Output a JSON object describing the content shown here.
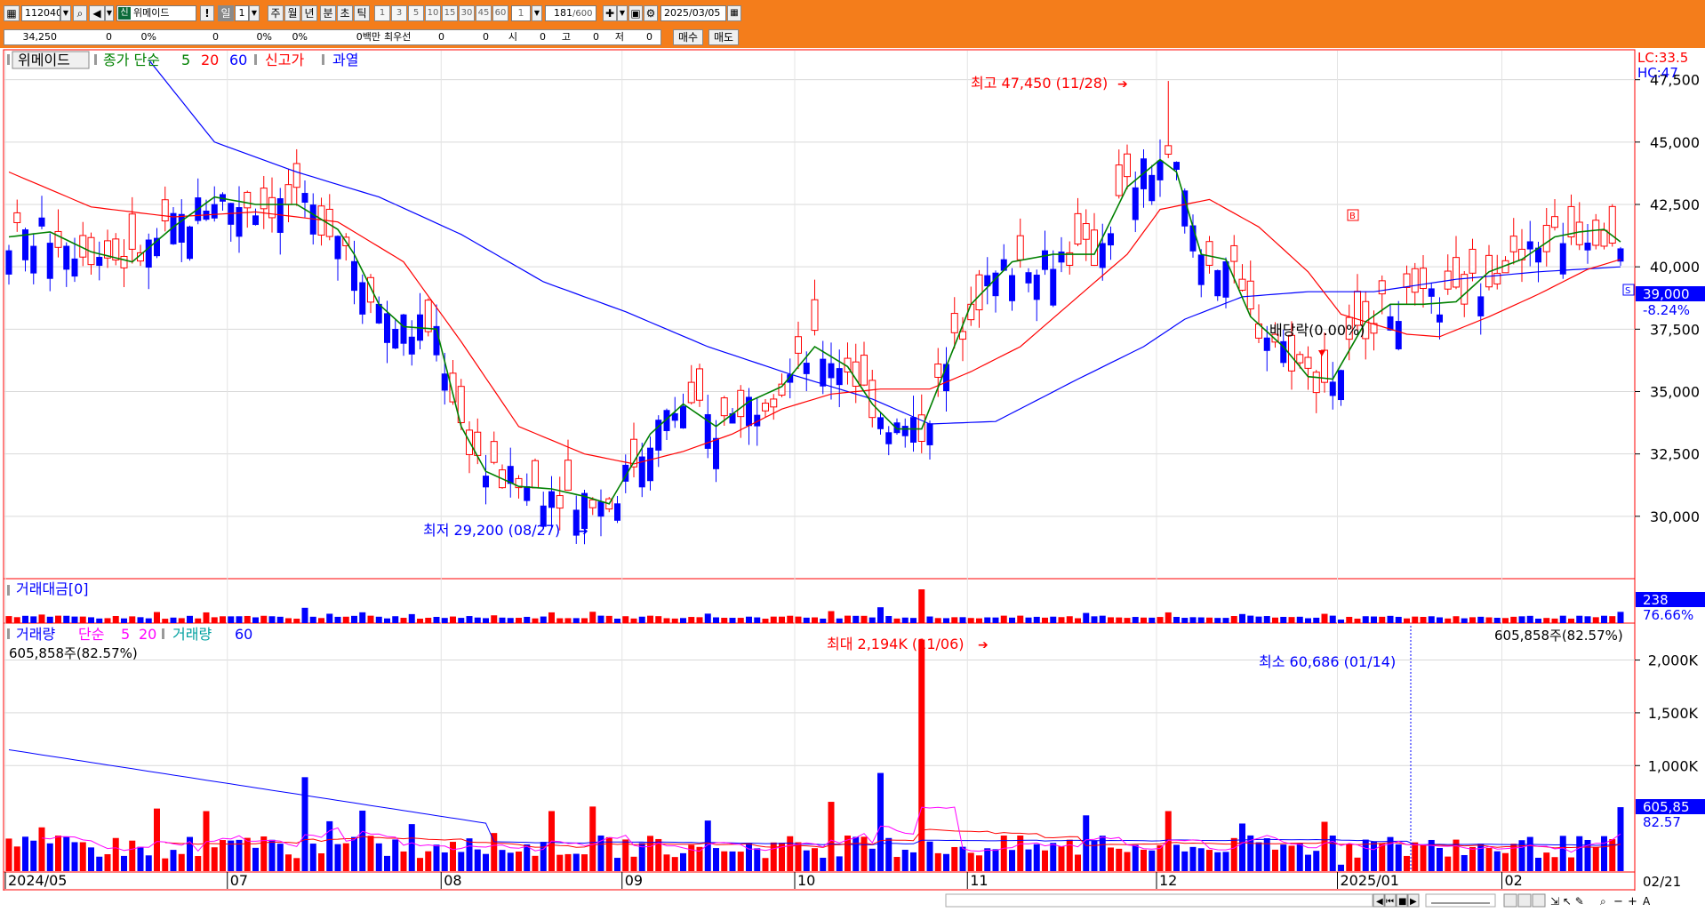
{
  "toolbar": {
    "code": "112040",
    "credit_badge": "신",
    "name": "위메이드",
    "alert": "!",
    "period_buttons": [
      "일",
      "1",
      "주",
      "월",
      "년",
      "분",
      "초",
      "틱"
    ],
    "minute_buttons": [
      "1",
      "3",
      "5",
      "10",
      "15",
      "30",
      "45",
      "60",
      "1"
    ],
    "count": "181",
    "count_total": "/600",
    "date": "2025/03/05"
  },
  "quote": {
    "price": "34,250",
    "change": "0",
    "change_pct": "0%",
    "volume": "0",
    "vol_pct": "0%",
    "turnover_pct": "0%",
    "amount": "0백만",
    "best_bid_label": "최우선",
    "bid1": "0",
    "bid2": "0",
    "open_label": "시",
    "open": "0",
    "high_label": "고",
    "high": "0",
    "low_label": "저",
    "low": "0",
    "buy_label": "매수",
    "sell_label": "매도"
  },
  "price_legend": {
    "name": "위메이드",
    "ma_label": "종가 단순",
    "ma_periods": [
      "5",
      "20",
      "60"
    ],
    "high52": "신고가",
    "overheat": "과열"
  },
  "annotations": {
    "high": "최고 47,450 (11/28)",
    "low": "최저 29,200 (08/27)",
    "dividend": "배당락(0.00%)",
    "vol_max": "최대 2,194K (11/06)",
    "vol_min": "최소 60,686 (01/14)",
    "vol_current": "605,858주(82.57%)"
  },
  "right_panel": {
    "lc": "LC:33.5",
    "hc": "HC:47",
    "price_badge": "39,000",
    "price_change": "-8.24%",
    "amt_badge": "238",
    "amt_pct": "76.66%",
    "vol_badge": "605,85",
    "vol_pct": "82.57"
  },
  "amount_panel": {
    "title": "거래대금[0]"
  },
  "volume_legend": {
    "label": "거래량",
    "ma_label": "단순",
    "p1": "5",
    "p2": "20",
    "label2": "거래량",
    "p3": "60"
  },
  "bottom": {
    "last_date": "02/21"
  },
  "colors": {
    "up": "#ff0000",
    "down": "#0000ff",
    "ma5": "#008000",
    "ma20": "#ff0000",
    "ma60": "#0000ff",
    "toolbar": "#f47d1b",
    "vol_ma5": "#ff00ff",
    "vol_ma20": "#ff0000",
    "vol_ma60": "#0000ff"
  },
  "chart_data": {
    "type": "candlestick",
    "y_ticks": [
      30000,
      32500,
      35000,
      37500,
      40000,
      42500,
      45000,
      47500
    ],
    "y_tick_labels": [
      "30,000",
      "32,500",
      "35,000",
      "37,500",
      "40,000",
      "42,500",
      "45,000",
      "47,500"
    ],
    "ylim": [
      27500,
      48700
    ],
    "x_labels": [
      {
        "label": "2024/05",
        "index": 0
      },
      {
        "label": "07",
        "index": 27
      },
      {
        "label": "08",
        "index": 53
      },
      {
        "label": "09",
        "index": 75
      },
      {
        "label": "10",
        "index": 96
      },
      {
        "label": "11",
        "index": 117
      },
      {
        "label": "12",
        "index": 140
      },
      {
        "label": "2025/01",
        "index": 162
      },
      {
        "label": "02",
        "index": 182
      }
    ],
    "ma5_points": [
      [
        0,
        41200
      ],
      [
        5,
        41400
      ],
      [
        10,
        40600
      ],
      [
        15,
        40200
      ],
      [
        20,
        41600
      ],
      [
        25,
        42800
      ],
      [
        30,
        42500
      ],
      [
        35,
        42500
      ],
      [
        40,
        41500
      ],
      [
        42,
        40500
      ],
      [
        45,
        38500
      ],
      [
        48,
        37600
      ],
      [
        52,
        37500
      ],
      [
        55,
        33600
      ],
      [
        58,
        31800
      ],
      [
        62,
        31200
      ],
      [
        66,
        31100
      ],
      [
        70,
        30800
      ],
      [
        73,
        30500
      ],
      [
        78,
        33300
      ],
      [
        82,
        34500
      ],
      [
        86,
        33600
      ],
      [
        90,
        34600
      ],
      [
        94,
        35200
      ],
      [
        98,
        36800
      ],
      [
        102,
        36000
      ],
      [
        105,
        34500
      ],
      [
        108,
        33500
      ],
      [
        111,
        33500
      ],
      [
        114,
        36000
      ],
      [
        117,
        38500
      ],
      [
        122,
        40200
      ],
      [
        127,
        40500
      ],
      [
        132,
        40500
      ],
      [
        136,
        43200
      ],
      [
        140,
        44300
      ],
      [
        142,
        43800
      ],
      [
        145,
        40500
      ],
      [
        148,
        40300
      ],
      [
        151,
        38000
      ],
      [
        155,
        36800
      ],
      [
        158,
        35600
      ],
      [
        161,
        35500
      ],
      [
        165,
        37800
      ],
      [
        168,
        38500
      ],
      [
        172,
        38500
      ],
      [
        176,
        38600
      ],
      [
        180,
        39800
      ],
      [
        184,
        40300
      ],
      [
        188,
        41200
      ],
      [
        191,
        41400
      ],
      [
        194,
        41500
      ],
      [
        196,
        41000
      ]
    ],
    "ma20_points": [
      [
        0,
        43800
      ],
      [
        10,
        42400
      ],
      [
        20,
        42000
      ],
      [
        30,
        42200
      ],
      [
        40,
        41800
      ],
      [
        48,
        40200
      ],
      [
        55,
        37000
      ],
      [
        62,
        33600
      ],
      [
        70,
        32500
      ],
      [
        76,
        32100
      ],
      [
        82,
        32600
      ],
      [
        88,
        33300
      ],
      [
        94,
        34300
      ],
      [
        100,
        34900
      ],
      [
        106,
        35100
      ],
      [
        112,
        35100
      ],
      [
        117,
        35800
      ],
      [
        123,
        36800
      ],
      [
        130,
        38800
      ],
      [
        136,
        40500
      ],
      [
        140,
        42300
      ],
      [
        146,
        42700
      ],
      [
        152,
        41600
      ],
      [
        158,
        39800
      ],
      [
        162,
        38100
      ],
      [
        166,
        37700
      ],
      [
        170,
        37300
      ],
      [
        174,
        37200
      ],
      [
        180,
        38000
      ],
      [
        186,
        38900
      ],
      [
        192,
        39900
      ],
      [
        196,
        40300
      ]
    ],
    "ma60_points": [
      [
        17,
        48300
      ],
      [
        25,
        45000
      ],
      [
        35,
        43800
      ],
      [
        45,
        42800
      ],
      [
        55,
        41300
      ],
      [
        65,
        39400
      ],
      [
        75,
        38200
      ],
      [
        85,
        36800
      ],
      [
        95,
        35700
      ],
      [
        105,
        34700
      ],
      [
        112,
        33700
      ],
      [
        120,
        33800
      ],
      [
        130,
        35500
      ],
      [
        138,
        36800
      ],
      [
        143,
        37900
      ],
      [
        150,
        38800
      ],
      [
        158,
        39000
      ],
      [
        166,
        39000
      ],
      [
        176,
        39500
      ],
      [
        186,
        39800
      ],
      [
        196,
        40000
      ]
    ],
    "candles_note": "approx. 197 daily OHLC candles read from chart; key extremes: high 47450 on 11/28, low 29200 on 08/27",
    "volume": {
      "y_ticks": [
        1000000,
        1500000,
        2000000
      ],
      "y_tick_labels": [
        "1,000K",
        "1,500K",
        "2,000K"
      ],
      "ylim": [
        0,
        2350000
      ],
      "max": 2194000,
      "min": 60686
    }
  }
}
